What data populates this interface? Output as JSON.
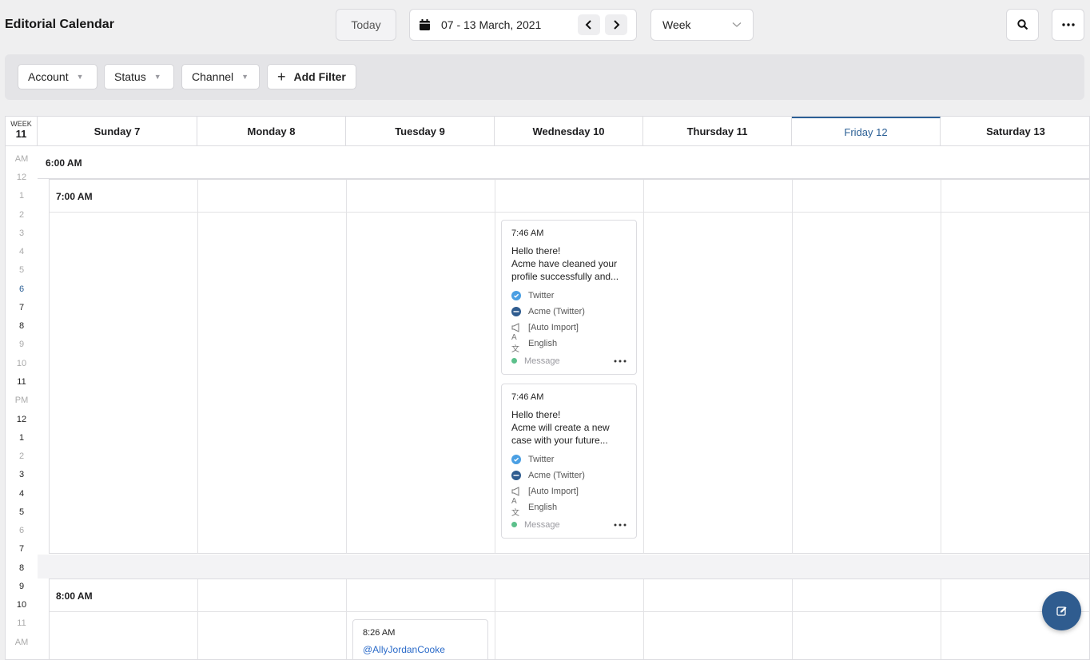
{
  "header": {
    "title": "Editorial Calendar",
    "today_label": "Today",
    "date_range": "07 - 13 March, 2021",
    "view_selected": "Week"
  },
  "filters": {
    "account": "Account",
    "status": "Status",
    "channel": "Channel",
    "add_filter": "Add Filter"
  },
  "calendar": {
    "week_label": "WEEK",
    "week_number": "11",
    "days": [
      "Sunday 7",
      "Monday 8",
      "Tuesday 9",
      "Wednesday 10",
      "Thursday 11",
      "Friday 12",
      "Saturday 13"
    ],
    "today_day": "Friday 12",
    "hour_rail": [
      "AM",
      "12",
      "1",
      "2",
      "3",
      "4",
      "5",
      "6",
      "7",
      "8",
      "9",
      "10",
      "11",
      "PM",
      "12",
      "1",
      "2",
      "3",
      "4",
      "5",
      "6",
      "7",
      "8",
      "9",
      "10",
      "11",
      "AM"
    ],
    "slots": [
      "6:00 AM",
      "7:00 AM",
      "8:00 AM"
    ]
  },
  "posts": [
    {
      "time": "7:46 AM",
      "text_line1": "Hello there!",
      "text_line2": "Acme have cleaned your profile successfully and...",
      "channel": "Twitter",
      "account": "Acme (Twitter)",
      "campaign": "[Auto Import]",
      "language": "English",
      "status": "Message"
    },
    {
      "time": "7:46 AM",
      "text_line1": "Hello there!",
      "text_line2": "Acme will create a new case with your future...",
      "channel": "Twitter",
      "account": "Acme (Twitter)",
      "campaign": "[Auto Import]",
      "language": "English",
      "status": "Message"
    },
    {
      "time": "8:26 AM",
      "handle": "@AllyJordanCooke"
    }
  ],
  "colors": {
    "accent": "#2b5f95",
    "twitter": "#4a9fe3",
    "status_green": "#5cc08b",
    "fab": "#2f5c8f"
  },
  "icons": {
    "calendar": "calendar-icon",
    "prev": "chevron-left-icon",
    "next": "chevron-right-icon",
    "dropdown": "chevron-down-icon",
    "search": "search-icon",
    "more": "more-horizontal-icon",
    "add": "plus-icon",
    "compose": "compose-icon"
  }
}
